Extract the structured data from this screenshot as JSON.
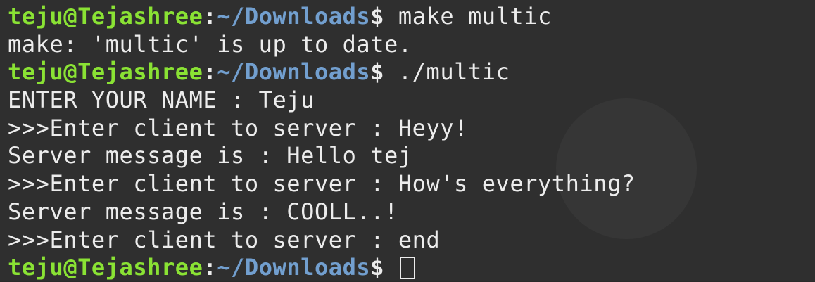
{
  "terminal": {
    "prompt": {
      "user_host": "teju@Tejashree",
      "separator": ":",
      "path": "~/Downloads",
      "symbol": "$"
    },
    "lines": [
      {
        "command": " make multic"
      },
      {
        "text": "make: 'multic' is up to date."
      },
      {
        "command": " ./multic"
      },
      {
        "text": "ENTER YOUR NAME : Teju"
      },
      {
        "text": ">>>Enter client to server : Heyy!"
      },
      {
        "text": "Server message is : Hello tej"
      },
      {
        "text": ">>>Enter client to server : How's everything?"
      },
      {
        "text": "Server message is : COOLL..!"
      },
      {
        "text": ">>>Enter client to server : end"
      }
    ]
  },
  "colors": {
    "background": "#2f2f2f",
    "user_host": "#8ae234",
    "path": "#729fcf",
    "text": "#ececec"
  }
}
